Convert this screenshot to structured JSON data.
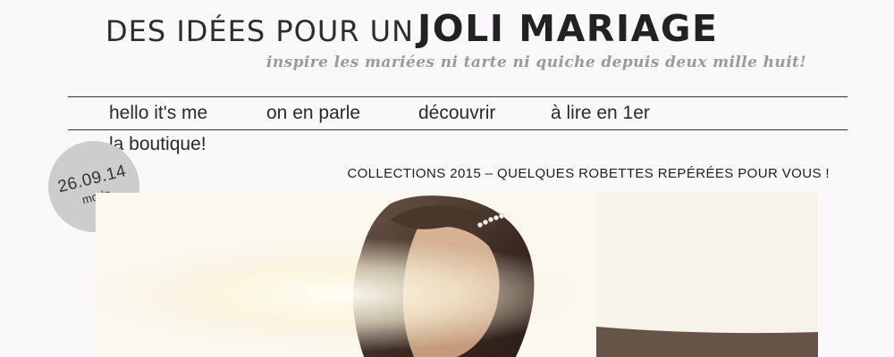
{
  "header": {
    "logo_prefix": "DES IDÉES POUR UN",
    "logo_main": "JOLI MARIAGE",
    "tagline": "inspire les mariées ni tarte ni quiche depuis deux mille huit!"
  },
  "nav": {
    "items": [
      "hello it's me",
      "on en parle",
      "découvrir",
      "à lire en 1er",
      "la boutique!"
    ]
  },
  "post": {
    "date": "26.09.14",
    "category": "mode",
    "title": "COLLECTIONS 2015 – QUELQUES ROBETTES REPÉRÉES POUR VOUS !"
  },
  "colors": {
    "background": "#fbf8fb",
    "badge": "#cdcdcd",
    "tagline": "#9a9a9a"
  }
}
